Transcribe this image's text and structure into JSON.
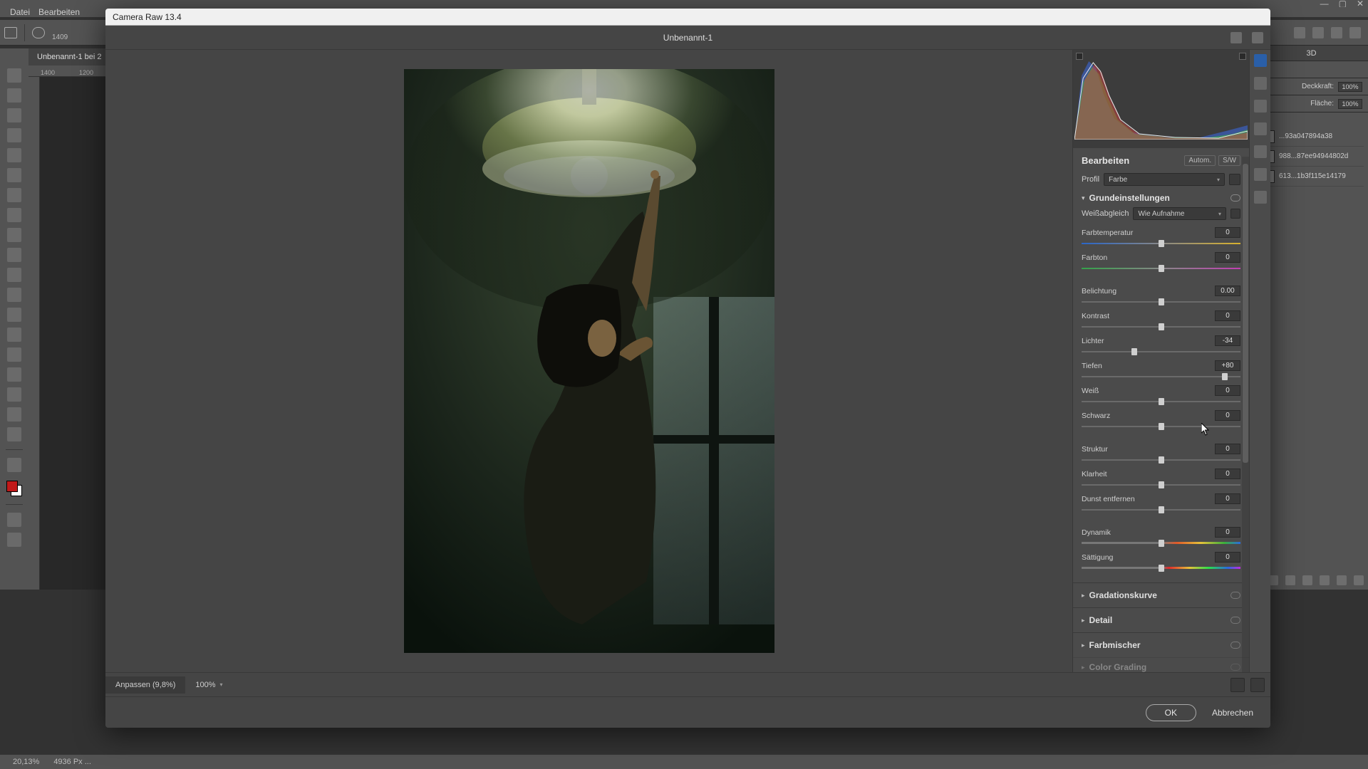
{
  "host": {
    "menubar": [
      "Datei",
      "Bearbeiten"
    ],
    "tab_label": "Unbenannt-1 bei 2",
    "ruler_marks": [
      "1400",
      "1200"
    ],
    "opt_value": "1409",
    "status_zoom": "20,13%",
    "status_doc": "4936 Px ..."
  },
  "host_right": {
    "tab": "3D",
    "opacity_label": "Deckkraft:",
    "opacity_value": "100%",
    "fill_label": "Fläche:",
    "fill_value": "100%",
    "layers": [
      "...93a047894a38",
      "988...87ee94944802d",
      "613...1b3f115e14179"
    ]
  },
  "cr": {
    "title": "Camera Raw 13.4",
    "doc_name": "Unbenannt-1",
    "edit_label": "Bearbeiten",
    "auto_label": "Autom.",
    "bw_label": "S/W",
    "profile_label": "Profil",
    "profile_value": "Farbe",
    "basic_section": "Grundeinstellungen",
    "wb_label": "Weißabgleich",
    "wb_value": "Wie Aufnahme",
    "sliders": {
      "temp": {
        "label": "Farbtemperatur",
        "value": "0",
        "pos": 50,
        "grad": "grad-temp"
      },
      "tint": {
        "label": "Farbton",
        "value": "0",
        "pos": 50,
        "grad": "grad-tint"
      },
      "exposure": {
        "label": "Belichtung",
        "value": "0.00",
        "pos": 50
      },
      "contrast": {
        "label": "Kontrast",
        "value": "0",
        "pos": 50
      },
      "highlights": {
        "label": "Lichter",
        "value": "-34",
        "pos": 33
      },
      "shadows": {
        "label": "Tiefen",
        "value": "+80",
        "pos": 90
      },
      "whites": {
        "label": "Weiß",
        "value": "0",
        "pos": 50
      },
      "blacks": {
        "label": "Schwarz",
        "value": "0",
        "pos": 50
      },
      "texture": {
        "label": "Struktur",
        "value": "0",
        "pos": 50
      },
      "clarity": {
        "label": "Klarheit",
        "value": "0",
        "pos": 50
      },
      "dehaze": {
        "label": "Dunst entfernen",
        "value": "0",
        "pos": 50
      },
      "vibrance": {
        "label": "Dynamik",
        "value": "0",
        "pos": 50,
        "grad": "grad-vib"
      },
      "saturation": {
        "label": "Sättigung",
        "value": "0",
        "pos": 50,
        "grad": "grad-sat"
      }
    },
    "collapsed": [
      "Gradationskurve",
      "Detail",
      "Farbmischer",
      "Color Grading"
    ],
    "fit_label": "Anpassen (9,8%)",
    "zoom_label": "100%",
    "ok_label": "OK",
    "cancel_label": "Abbrechen"
  }
}
